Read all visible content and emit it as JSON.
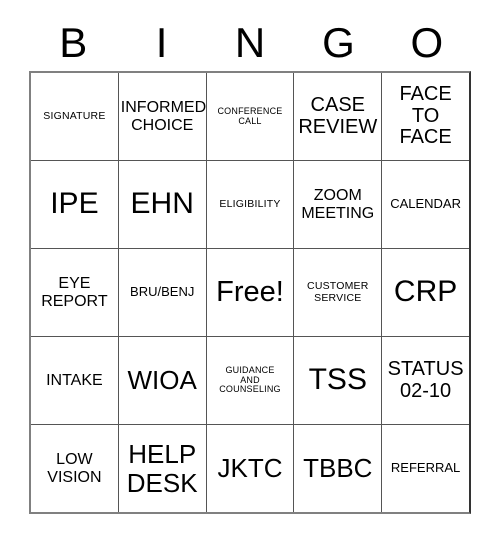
{
  "card": {
    "header_letters": [
      "B",
      "I",
      "N",
      "G",
      "O"
    ],
    "columns": 5,
    "rows": 5,
    "free_space": {
      "row": 3,
      "column": 3,
      "label": "Free!"
    },
    "cells": [
      [
        {
          "text": "SIGNATURE",
          "size": "s-xs"
        },
        {
          "text": "INFORMED\nCHOICE",
          "size": "s-md"
        },
        {
          "text": "CONFERENCE\nCALL",
          "size": "s-xxs"
        },
        {
          "text": "CASE\nREVIEW",
          "size": "s-lg"
        },
        {
          "text": "FACE\nTO\nFACE",
          "size": "s-lg"
        }
      ],
      [
        {
          "text": "IPE",
          "size": "s-xxl"
        },
        {
          "text": "EHN",
          "size": "s-xxl"
        },
        {
          "text": "ELIGIBILITY",
          "size": "s-xs"
        },
        {
          "text": "ZOOM\nMEETING",
          "size": "s-md"
        },
        {
          "text": "CALENDAR",
          "size": "s-sm"
        }
      ],
      [
        {
          "text": "EYE\nREPORT",
          "size": "s-md"
        },
        {
          "text": "BRU/BENJ",
          "size": "s-sm"
        },
        {
          "text": "Free!",
          "size": "s-free"
        },
        {
          "text": "CUSTOMER\nSERVICE",
          "size": "s-xs"
        },
        {
          "text": "CRP",
          "size": "s-xxl"
        }
      ],
      [
        {
          "text": "INTAKE",
          "size": "s-md"
        },
        {
          "text": "WIOA",
          "size": "s-xl"
        },
        {
          "text": "GUIDANCE\nAND\nCOUNSELING",
          "size": "s-xxs"
        },
        {
          "text": "TSS",
          "size": "s-xxl"
        },
        {
          "text": "STATUS\n02-10",
          "size": "s-lg"
        }
      ],
      [
        {
          "text": "LOW\nVISION",
          "size": "s-md"
        },
        {
          "text": "HELP\nDESK",
          "size": "s-xl"
        },
        {
          "text": "JKTC",
          "size": "s-xl"
        },
        {
          "text": "TBBC",
          "size": "s-xl"
        },
        {
          "text": "REFERRAL",
          "size": "s-sm"
        }
      ]
    ]
  },
  "colors": {
    "background": "#ffffff",
    "text": "#000000",
    "grid_line": "#555555",
    "grid_border": "#808080"
  }
}
